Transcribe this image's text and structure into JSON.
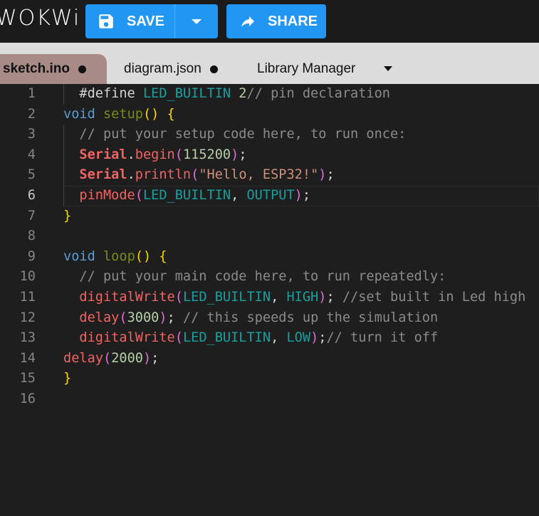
{
  "header": {
    "logo": "WOKWi",
    "save_label": "SAVE",
    "share_label": "SHARE",
    "icons": [
      "save-icon",
      "chevron-down-icon",
      "share-icon"
    ]
  },
  "tabs": [
    {
      "label": "sketch.ino",
      "unsaved": true,
      "active": true
    },
    {
      "label": "diagram.json",
      "unsaved": true
    },
    {
      "label": "Library Manager"
    }
  ],
  "editor": {
    "current_line": 6,
    "lines": [
      {
        "n": "1",
        "tokens": [
          [
            "  #define ",
            "t"
          ],
          [
            "LED_BUILTIN ",
            "c"
          ],
          [
            "2",
            "num"
          ],
          [
            "// pin declaration",
            "cm"
          ]
        ]
      },
      {
        "n": "2",
        "tokens": [
          [
            "void ",
            "kw"
          ],
          [
            "setup",
            "fn"
          ],
          [
            "() {",
            "br"
          ]
        ]
      },
      {
        "n": "3",
        "tokens": [
          [
            "  // put your setup code here, to run once:",
            "cm"
          ]
        ]
      },
      {
        "n": "4",
        "tokens": [
          [
            "  Serial",
            "ser"
          ],
          [
            ".",
            "t"
          ],
          [
            "begin",
            "m"
          ],
          [
            "(",
            "p"
          ],
          [
            "115200",
            "num"
          ],
          [
            ")",
            "p"
          ],
          [
            ";",
            "t"
          ]
        ]
      },
      {
        "n": "5",
        "tokens": [
          [
            "  Serial",
            "ser"
          ],
          [
            ".",
            "t"
          ],
          [
            "println",
            "m"
          ],
          [
            "(",
            "p"
          ],
          [
            "\"Hello, ESP32!\"",
            "str"
          ],
          [
            ")",
            "p"
          ],
          [
            ";",
            "t"
          ]
        ]
      },
      {
        "n": "6",
        "tokens": [
          [
            "  pinMode",
            "m"
          ],
          [
            "(",
            "p"
          ],
          [
            "LED_BUILTIN",
            "c"
          ],
          [
            ", ",
            "t"
          ],
          [
            "OUTPUT",
            "c"
          ],
          [
            ")",
            "p"
          ],
          [
            ";",
            "t"
          ]
        ]
      },
      {
        "n": "7",
        "tokens": [
          [
            "}",
            "br"
          ]
        ]
      },
      {
        "n": "8",
        "tokens": []
      },
      {
        "n": "9",
        "tokens": [
          [
            "void ",
            "kw"
          ],
          [
            "loop",
            "fn"
          ],
          [
            "() {",
            "br"
          ]
        ]
      },
      {
        "n": "10",
        "tokens": [
          [
            "  // put your main code here, to run repeatedly:",
            "cm"
          ]
        ]
      },
      {
        "n": "11",
        "tokens": [
          [
            "  digitalWrite",
            "m"
          ],
          [
            "(",
            "p"
          ],
          [
            "LED_BUILTIN",
            "c"
          ],
          [
            ", ",
            "t"
          ],
          [
            "HIGH",
            "c"
          ],
          [
            ")",
            "p"
          ],
          [
            "; ",
            "t"
          ],
          [
            "//set built in Led high",
            "cm"
          ]
        ]
      },
      {
        "n": "12",
        "tokens": [
          [
            "  delay",
            "m"
          ],
          [
            "(",
            "p"
          ],
          [
            "3000",
            "num"
          ],
          [
            ")",
            "p"
          ],
          [
            "; ",
            "t"
          ],
          [
            "// this speeds up the simulation",
            "cm"
          ]
        ]
      },
      {
        "n": "13",
        "tokens": [
          [
            "  digitalWrite",
            "m"
          ],
          [
            "(",
            "p"
          ],
          [
            "LED_BUILTIN",
            "c"
          ],
          [
            ", ",
            "t"
          ],
          [
            "LOW",
            "c"
          ],
          [
            ")",
            "p"
          ],
          [
            ";",
            "t"
          ],
          [
            "// turn it off",
            "cm"
          ]
        ]
      },
      {
        "n": "14",
        "tokens": [
          [
            "delay",
            "m"
          ],
          [
            "(",
            "p"
          ],
          [
            "2000",
            "num"
          ],
          [
            ")",
            "p"
          ],
          [
            ";",
            "t"
          ]
        ]
      },
      {
        "n": "15",
        "tokens": [
          [
            "}",
            "br"
          ]
        ]
      },
      {
        "n": "16",
        "tokens": []
      }
    ]
  }
}
